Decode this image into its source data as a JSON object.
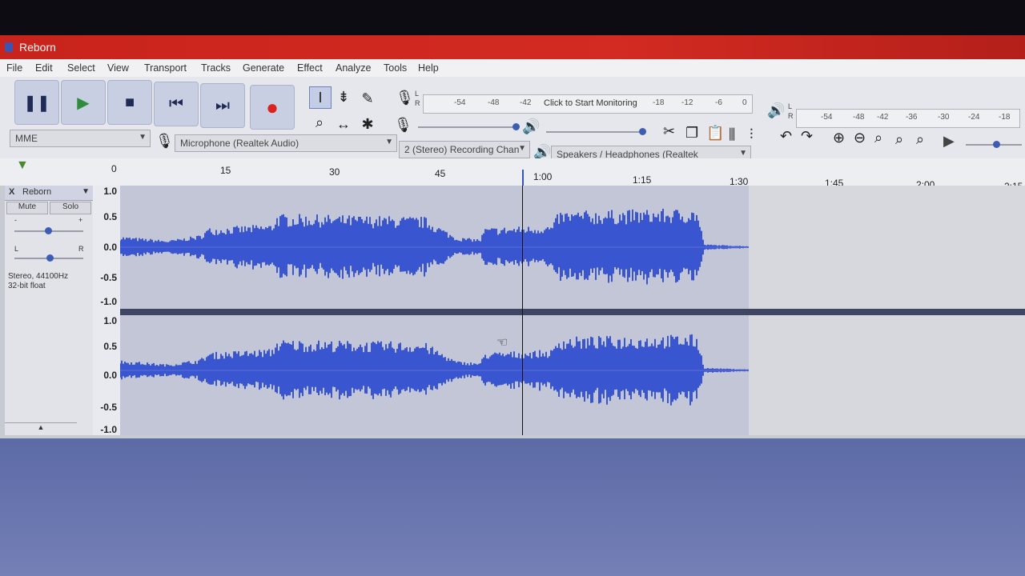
{
  "window": {
    "title": "Reborn"
  },
  "menu": [
    "File",
    "Edit",
    "Select",
    "View",
    "Transport",
    "Tracks",
    "Generate",
    "Effect",
    "Analyze",
    "Tools",
    "Help"
  ],
  "transport": {
    "pause_icon": "pause-icon",
    "play_icon": "play-icon",
    "stop_icon": "stop-icon",
    "skip_start_icon": "skip-start-icon",
    "skip_end_icon": "skip-end-icon",
    "record_icon": "record-icon",
    "record_color": "#d8231e"
  },
  "meters": {
    "record_ticks": [
      "-54",
      "-48",
      "-42"
    ],
    "click_to_monitor": "Click to Start Monitoring",
    "record_ticks_right": [
      "-18",
      "-12",
      "-6",
      "0"
    ],
    "playback_ticks": [
      "-54",
      "-48",
      "-42",
      "-36",
      "-30",
      "-24",
      "-18"
    ],
    "lr": [
      "L",
      "R"
    ]
  },
  "devices": {
    "host": "MME",
    "mic": "Microphone (Realtek Audio)",
    "channels": "2 (Stereo) Recording Chan",
    "speakers": "Speakers / Headphones (Realtek"
  },
  "timeline": {
    "labels": [
      "0",
      "15",
      "30",
      "45",
      "1:00",
      "1:15",
      "1:30",
      "1:45",
      "2:00",
      "2:15"
    ]
  },
  "track": {
    "name": "Reborn",
    "close": "X",
    "mute": "Mute",
    "solo": "Solo",
    "gain_minus": "-",
    "gain_plus": "+",
    "pan_left": "L",
    "pan_right": "R",
    "info_rate": "Stereo, 44100Hz",
    "info_format": "32-bit float",
    "collapse": "▲",
    "scale": [
      "1.0",
      "0.5",
      "0.0",
      "-0.5",
      "-1.0"
    ],
    "wave_color": "#3a55d0",
    "playhead_seconds": 60
  }
}
